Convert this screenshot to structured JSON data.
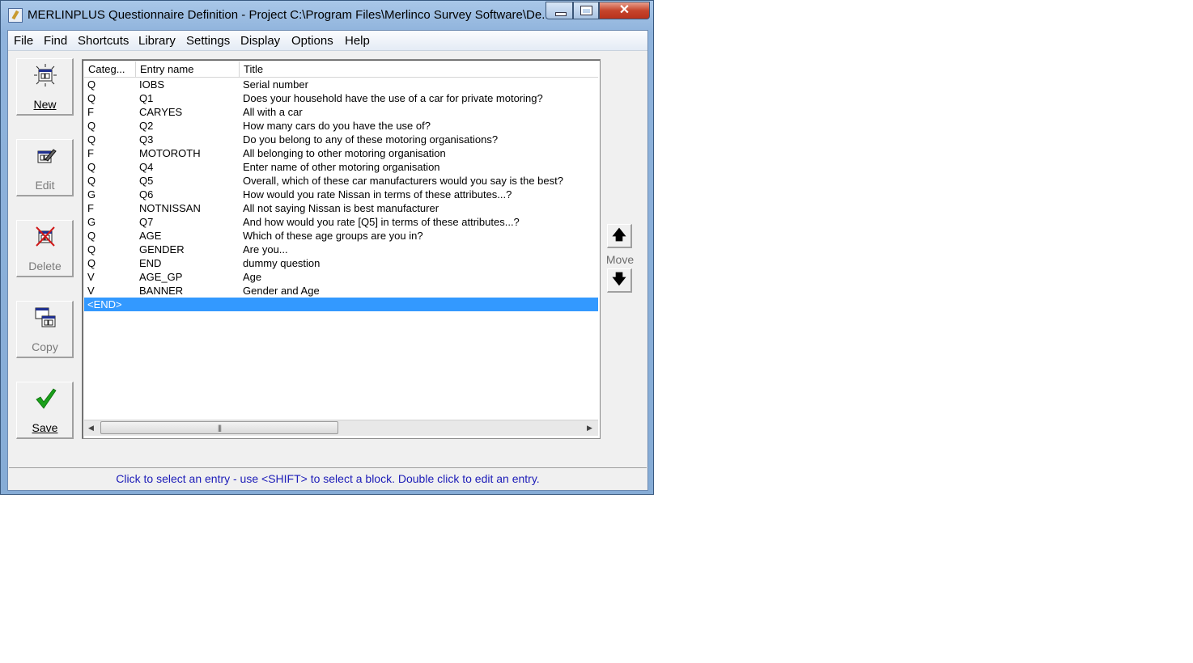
{
  "window": {
    "title": "MERLINPLUS Questionnaire Definition - Project C:\\Program Files\\Merlinco Survey Software\\De...",
    "close_glyph": "✕"
  },
  "menu": [
    "File",
    "Find",
    "Shortcuts",
    "Library",
    "Settings",
    "Display",
    "Options",
    "Help"
  ],
  "toolbar": {
    "new": {
      "label": "New",
      "icon": "new-window-icon"
    },
    "edit": {
      "label": "Edit",
      "icon": "edit-icon"
    },
    "delete": {
      "label": "Delete",
      "icon": "delete-icon"
    },
    "copy": {
      "label": "Copy",
      "icon": "copy-icon"
    },
    "save": {
      "label": "Save",
      "icon": "checkmark-icon"
    }
  },
  "list": {
    "columns": [
      "Categ...",
      "Entry name",
      "Title"
    ],
    "rows": [
      [
        "Q",
        "IOBS",
        "Serial number"
      ],
      [
        "Q",
        "Q1",
        "Does your household have the use of a car for private motoring?"
      ],
      [
        "F",
        "CARYES",
        "All with a car"
      ],
      [
        "Q",
        "Q2",
        "How many cars do you have the use of?"
      ],
      [
        "Q",
        "Q3",
        "Do you belong to any of these motoring organisations?"
      ],
      [
        "F",
        "MOTOROTH",
        "All belonging to other motoring organisation"
      ],
      [
        "Q",
        "Q4",
        "Enter name of other motoring organisation"
      ],
      [
        "Q",
        "Q5",
        "Overall, which of these car manufacturers would you say is the best?"
      ],
      [
        "G",
        "Q6",
        "How would you rate Nissan in terms of these attributes...?"
      ],
      [
        "F",
        "NOTNISSAN",
        "All not saying Nissan is best manufacturer"
      ],
      [
        "G",
        "Q7",
        "And how would you rate [Q5] in terms of these attributes...?"
      ],
      [
        "Q",
        "AGE",
        "Which of these age groups are you in?"
      ],
      [
        "Q",
        "GENDER",
        "Are you..."
      ],
      [
        "Q",
        "END",
        "dummy question"
      ],
      [
        "V",
        "AGE_GP",
        "Age"
      ],
      [
        "V",
        "BANNER",
        "Gender and Age"
      ]
    ],
    "selected_row": "<END>"
  },
  "move": {
    "label": "Move",
    "up_icon": "arrow-up-icon",
    "down_icon": "arrow-down-icon",
    "up_glyph": "🡅",
    "down_glyph": "🡇"
  },
  "status_text": "Click to select an entry - use <SHIFT> to select a block. Double click to edit an entry.",
  "colors": {
    "selection": "#3399ff",
    "status_text": "#1c1cb8",
    "save_check": "#1aa01a"
  }
}
